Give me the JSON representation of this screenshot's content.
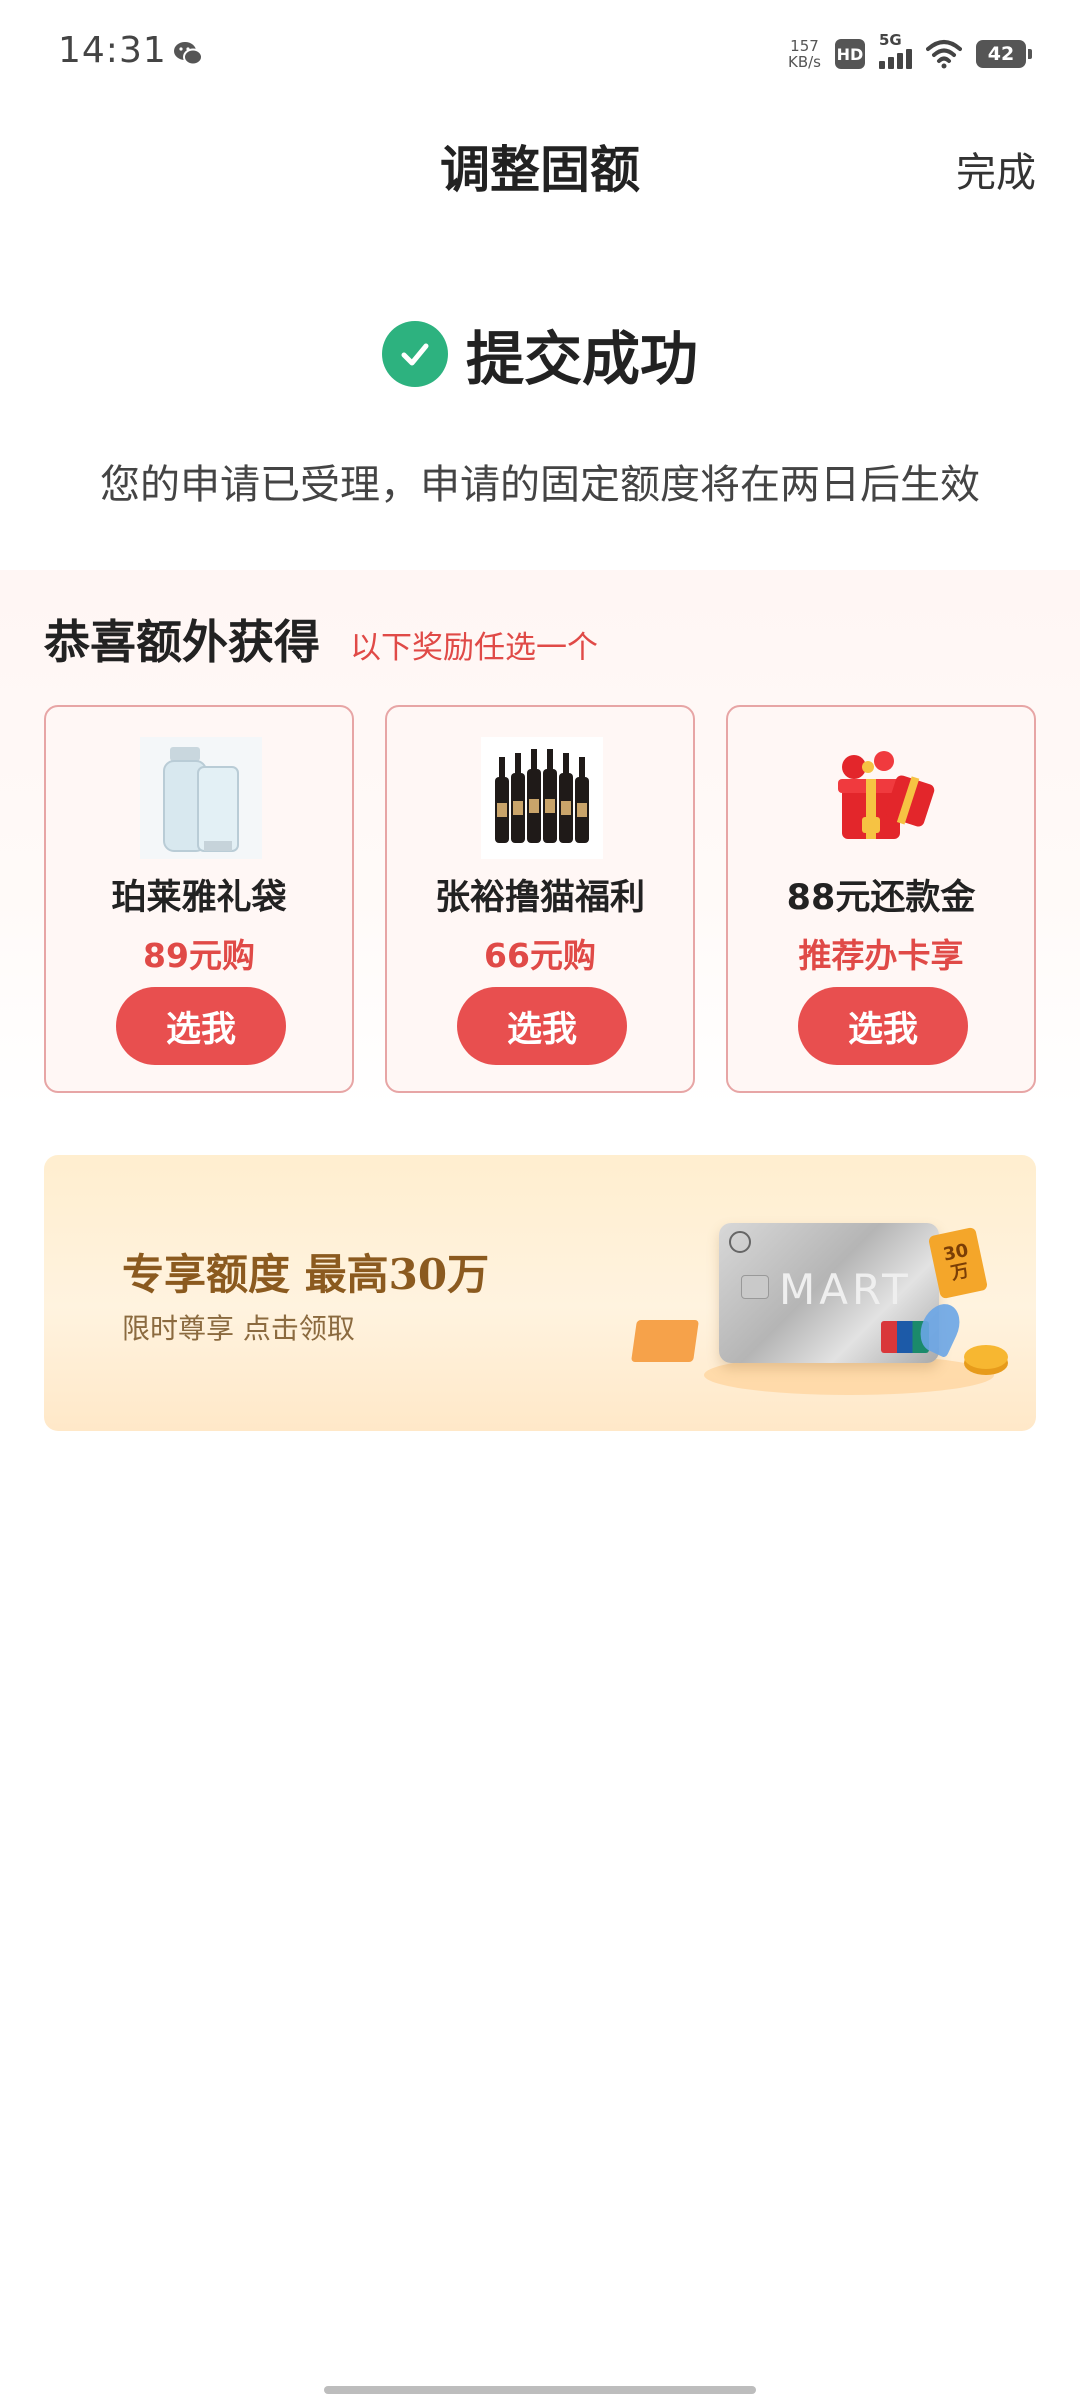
{
  "status_bar": {
    "time": "14:31",
    "net_speed_value": "157",
    "net_speed_unit": "KB/s",
    "hd_label": "HD",
    "network_label": "5G",
    "battery_level": "42"
  },
  "nav": {
    "title": "调整固额",
    "done_label": "完成"
  },
  "success": {
    "title": "提交成功",
    "description": "您的申请已受理，申请的固定额度将在两日后生效"
  },
  "rewards": {
    "title": "恭喜额外获得",
    "subtitle": "以下奖励任选一个",
    "items": [
      {
        "name": "珀莱雅礼袋",
        "price": "89元购",
        "button": "选我",
        "icon": "skincare-product-icon"
      },
      {
        "name": "张裕撸猫福利",
        "price": "66元购",
        "button": "选我",
        "icon": "wine-bottles-icon"
      },
      {
        "name": "88元还款金",
        "price": "推荐办卡享",
        "button": "选我",
        "icon": "red-gift-box-icon"
      }
    ]
  },
  "banner": {
    "title": "专享额度 最高30万",
    "subtitle": "限时尊享 点击领取",
    "card_text": "MART",
    "tag_line1": "30",
    "tag_line2": "万"
  },
  "colors": {
    "accent_red": "#e84f4f",
    "success_green": "#2db27f",
    "banner_gold": "#8b5a1f"
  }
}
